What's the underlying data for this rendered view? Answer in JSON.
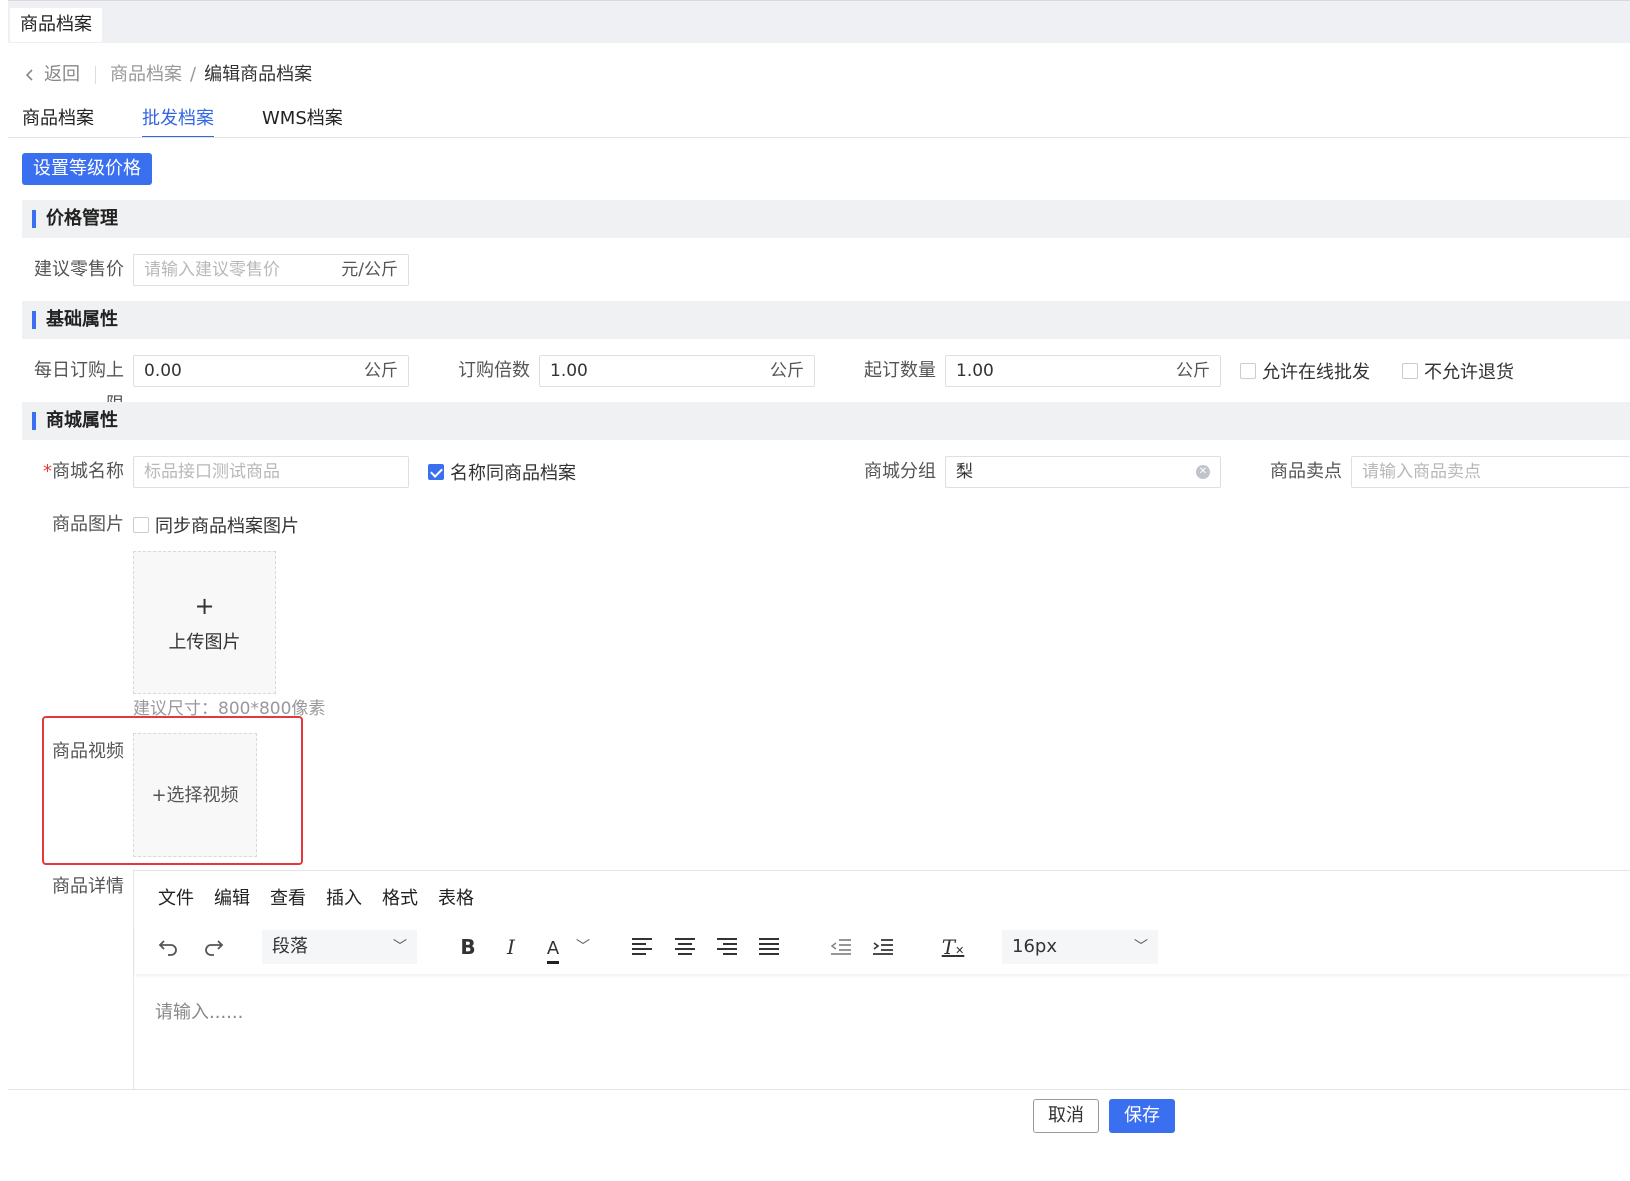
{
  "page_tab": "商品档案",
  "nav": {
    "back_label": "返回",
    "breadcrumb": [
      "商品档案",
      "/",
      "编辑商品档案"
    ]
  },
  "tabs": [
    {
      "label": "商品档案",
      "active": false
    },
    {
      "label": "批发档案",
      "active": true
    },
    {
      "label": "WMS档案",
      "active": false
    }
  ],
  "set_price_button": "设置等级价格",
  "sections": {
    "price": "价格管理",
    "basic": "基础属性",
    "mall": "商城属性"
  },
  "price": {
    "retail_label": "建议零售价",
    "retail_placeholder": "请输入建议零售价",
    "retail_unit": "元/公斤"
  },
  "basic": {
    "daily_limit_label": "每日订购上限",
    "daily_limit_value": "0.00",
    "daily_limit_unit": "公斤",
    "multiple_label": "订购倍数",
    "multiple_value": "1.00",
    "multiple_unit": "公斤",
    "min_qty_label": "起订数量",
    "min_qty_value": "1.00",
    "min_qty_unit": "公斤",
    "allow_online_label": "允许在线批发",
    "no_return_label": "不允许退货"
  },
  "mall": {
    "required_mark": "*",
    "name_label": "商城名称",
    "name_placeholder": "标品接口测试商品",
    "same_name_label": "名称同商品档案",
    "group_label": "商城分组",
    "group_value": "梨",
    "selling_point_label": "商品卖点",
    "selling_point_placeholder": "请输入商品卖点",
    "image_label": "商品图片",
    "sync_image_label": "同步商品档案图片",
    "upload_plus": "+",
    "upload_label": "上传图片",
    "size_hint": "建议尺寸：800*800像素",
    "video_label": "商品视频",
    "choose_video": "+选择视频",
    "detail_label": "商品详情"
  },
  "editor": {
    "menu": [
      "文件",
      "编辑",
      "查看",
      "插入",
      "格式",
      "表格"
    ],
    "block_format": "段落",
    "font_size": "16px",
    "placeholder": "请输入......",
    "bold": "B",
    "italic": "I",
    "font_color": "A",
    "clear_format": "T",
    "icons": [
      "undo-icon",
      "redo-icon",
      "bold-icon",
      "italic-icon",
      "font-color-icon",
      "align-left-icon",
      "align-center-icon",
      "align-right-icon",
      "align-justify-icon",
      "outdent-icon",
      "indent-icon",
      "clear-format-icon"
    ]
  },
  "footer": {
    "cancel": "取消",
    "save": "保存"
  },
  "colors": {
    "primary": "#3a6ff0",
    "highlight_border": "#e4393c",
    "section_bg": "#f0f1f3"
  }
}
